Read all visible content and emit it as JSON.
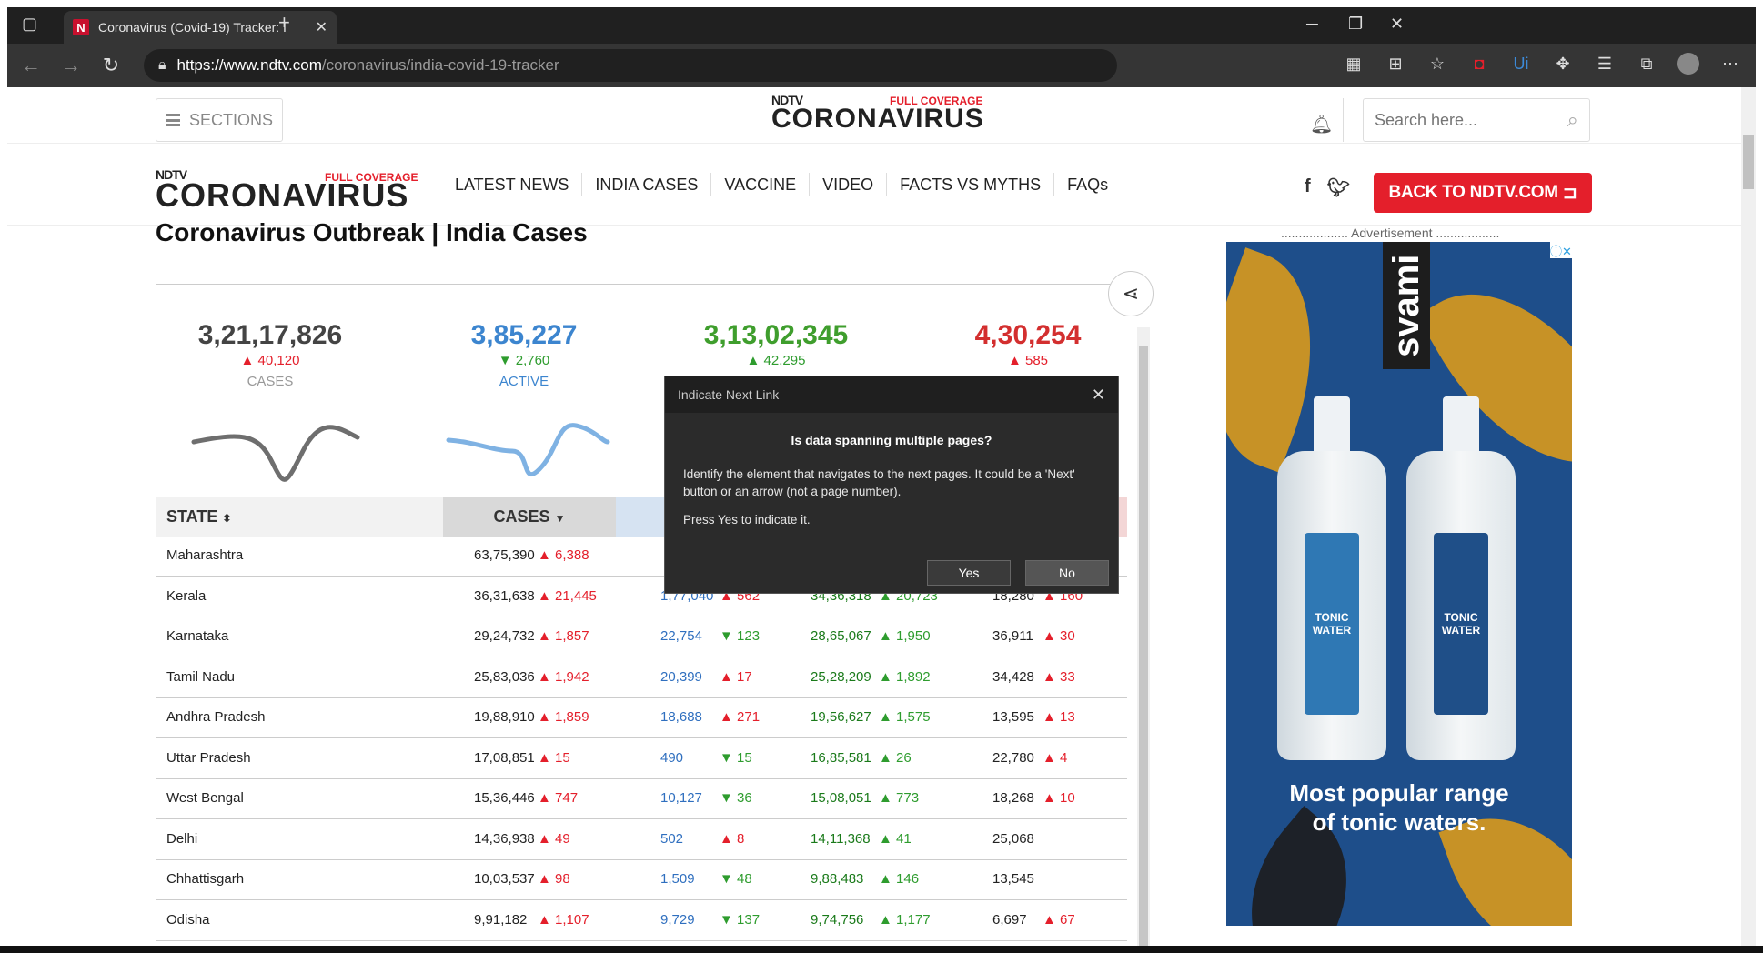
{
  "browser": {
    "tab_title": "Coronavirus (Covid-19) Tracker: I",
    "url_domain": "https://www.ndtv.com",
    "url_path": "/coronavirus/india-covid-19-tracker"
  },
  "header": {
    "sections_label": "SECTIONS",
    "logo_small": "NDTV",
    "logo_big": "CORONAVIRUS",
    "full_coverage": "FULL COVERAGE",
    "search_placeholder": "Search here..."
  },
  "nav": {
    "items": [
      "LATEST NEWS",
      "INDIA CASES",
      "VACCINE",
      "VIDEO",
      "FACTS VS MYTHS",
      "FAQs"
    ],
    "back_button": "BACK TO NDTV.COM"
  },
  "page": {
    "title": "Coronavirus Outbreak | India Cases"
  },
  "stats": [
    {
      "value": "3,21,17,826",
      "delta": "▲ 40,120",
      "label": "CASES",
      "color": "#444444"
    },
    {
      "value": "3,85,227",
      "delta": "▼ 2,760",
      "label": "ACTIVE",
      "color": "#3c85cf"
    },
    {
      "value": "3,13,02,345",
      "delta": "▲ 42,295",
      "label": "",
      "color": "#3f9e2d"
    },
    {
      "value": "4,30,254",
      "delta": "▲ 585",
      "label": "",
      "color": "#d32f2f"
    }
  ],
  "table": {
    "headers": {
      "state": "STATE",
      "cases": "CASES"
    },
    "rows": [
      {
        "state": "Maharashtra",
        "cases": "63,75,390",
        "cases_d": "▲ 6,388",
        "active": "",
        "active_d": "",
        "rec": "",
        "rec_d": "",
        "deaths": "",
        "deaths_d": ""
      },
      {
        "state": "Kerala",
        "cases": "36,31,638",
        "cases_d": "▲ 21,445",
        "active": "1,77,040",
        "active_d": "▲ 562",
        "rec": "34,36,318",
        "rec_d": "▲ 20,723",
        "deaths": "18,280",
        "deaths_d": "▲ 160"
      },
      {
        "state": "Karnataka",
        "cases": "29,24,732",
        "cases_d": "▲ 1,857",
        "active": "22,754",
        "active_d": "▼ 123",
        "rec": "28,65,067",
        "rec_d": "▲ 1,950",
        "deaths": "36,911",
        "deaths_d": "▲ 30"
      },
      {
        "state": "Tamil Nadu",
        "cases": "25,83,036",
        "cases_d": "▲ 1,942",
        "active": "20,399",
        "active_d": "▲ 17",
        "rec": "25,28,209",
        "rec_d": "▲ 1,892",
        "deaths": "34,428",
        "deaths_d": "▲ 33"
      },
      {
        "state": "Andhra Pradesh",
        "cases": "19,88,910",
        "cases_d": "▲ 1,859",
        "active": "18,688",
        "active_d": "▲ 271",
        "rec": "19,56,627",
        "rec_d": "▲ 1,575",
        "deaths": "13,595",
        "deaths_d": "▲ 13"
      },
      {
        "state": "Uttar Pradesh",
        "cases": "17,08,851",
        "cases_d": "▲ 15",
        "active": "490",
        "active_d": "▼ 15",
        "rec": "16,85,581",
        "rec_d": "▲ 26",
        "deaths": "22,780",
        "deaths_d": "▲ 4"
      },
      {
        "state": "West Bengal",
        "cases": "15,36,446",
        "cases_d": "▲ 747",
        "active": "10,127",
        "active_d": "▼ 36",
        "rec": "15,08,051",
        "rec_d": "▲ 773",
        "deaths": "18,268",
        "deaths_d": "▲ 10"
      },
      {
        "state": "Delhi",
        "cases": "14,36,938",
        "cases_d": "▲ 49",
        "active": "502",
        "active_d": "▲ 8",
        "rec": "14,11,368",
        "rec_d": "▲ 41",
        "deaths": "25,068",
        "deaths_d": ""
      },
      {
        "state": "Chhattisgarh",
        "cases": "10,03,537",
        "cases_d": "▲ 98",
        "active": "1,509",
        "active_d": "▼ 48",
        "rec": "9,88,483",
        "rec_d": "▲ 146",
        "deaths": "13,545",
        "deaths_d": ""
      },
      {
        "state": "Odisha",
        "cases": "9,91,182",
        "cases_d": "▲ 1,107",
        "active": "9,729",
        "active_d": "▼ 137",
        "rec": "9,74,756",
        "rec_d": "▲ 1,177",
        "deaths": "6,697",
        "deaths_d": "▲ 67"
      }
    ]
  },
  "ad": {
    "label": "Advertisement",
    "brand": "svami",
    "tagline_1": "Most popular range",
    "tagline_2": "of tonic waters.",
    "bottle_label": "TONIC WATER"
  },
  "dialog": {
    "title": "Indicate Next Link",
    "question": "Is data spanning multiple pages?",
    "body": "Identify the element that navigates to the next pages. It could be a 'Next' button or an arrow (not a page number).",
    "body2": "Press Yes to indicate it.",
    "yes": "Yes",
    "no": "No"
  }
}
